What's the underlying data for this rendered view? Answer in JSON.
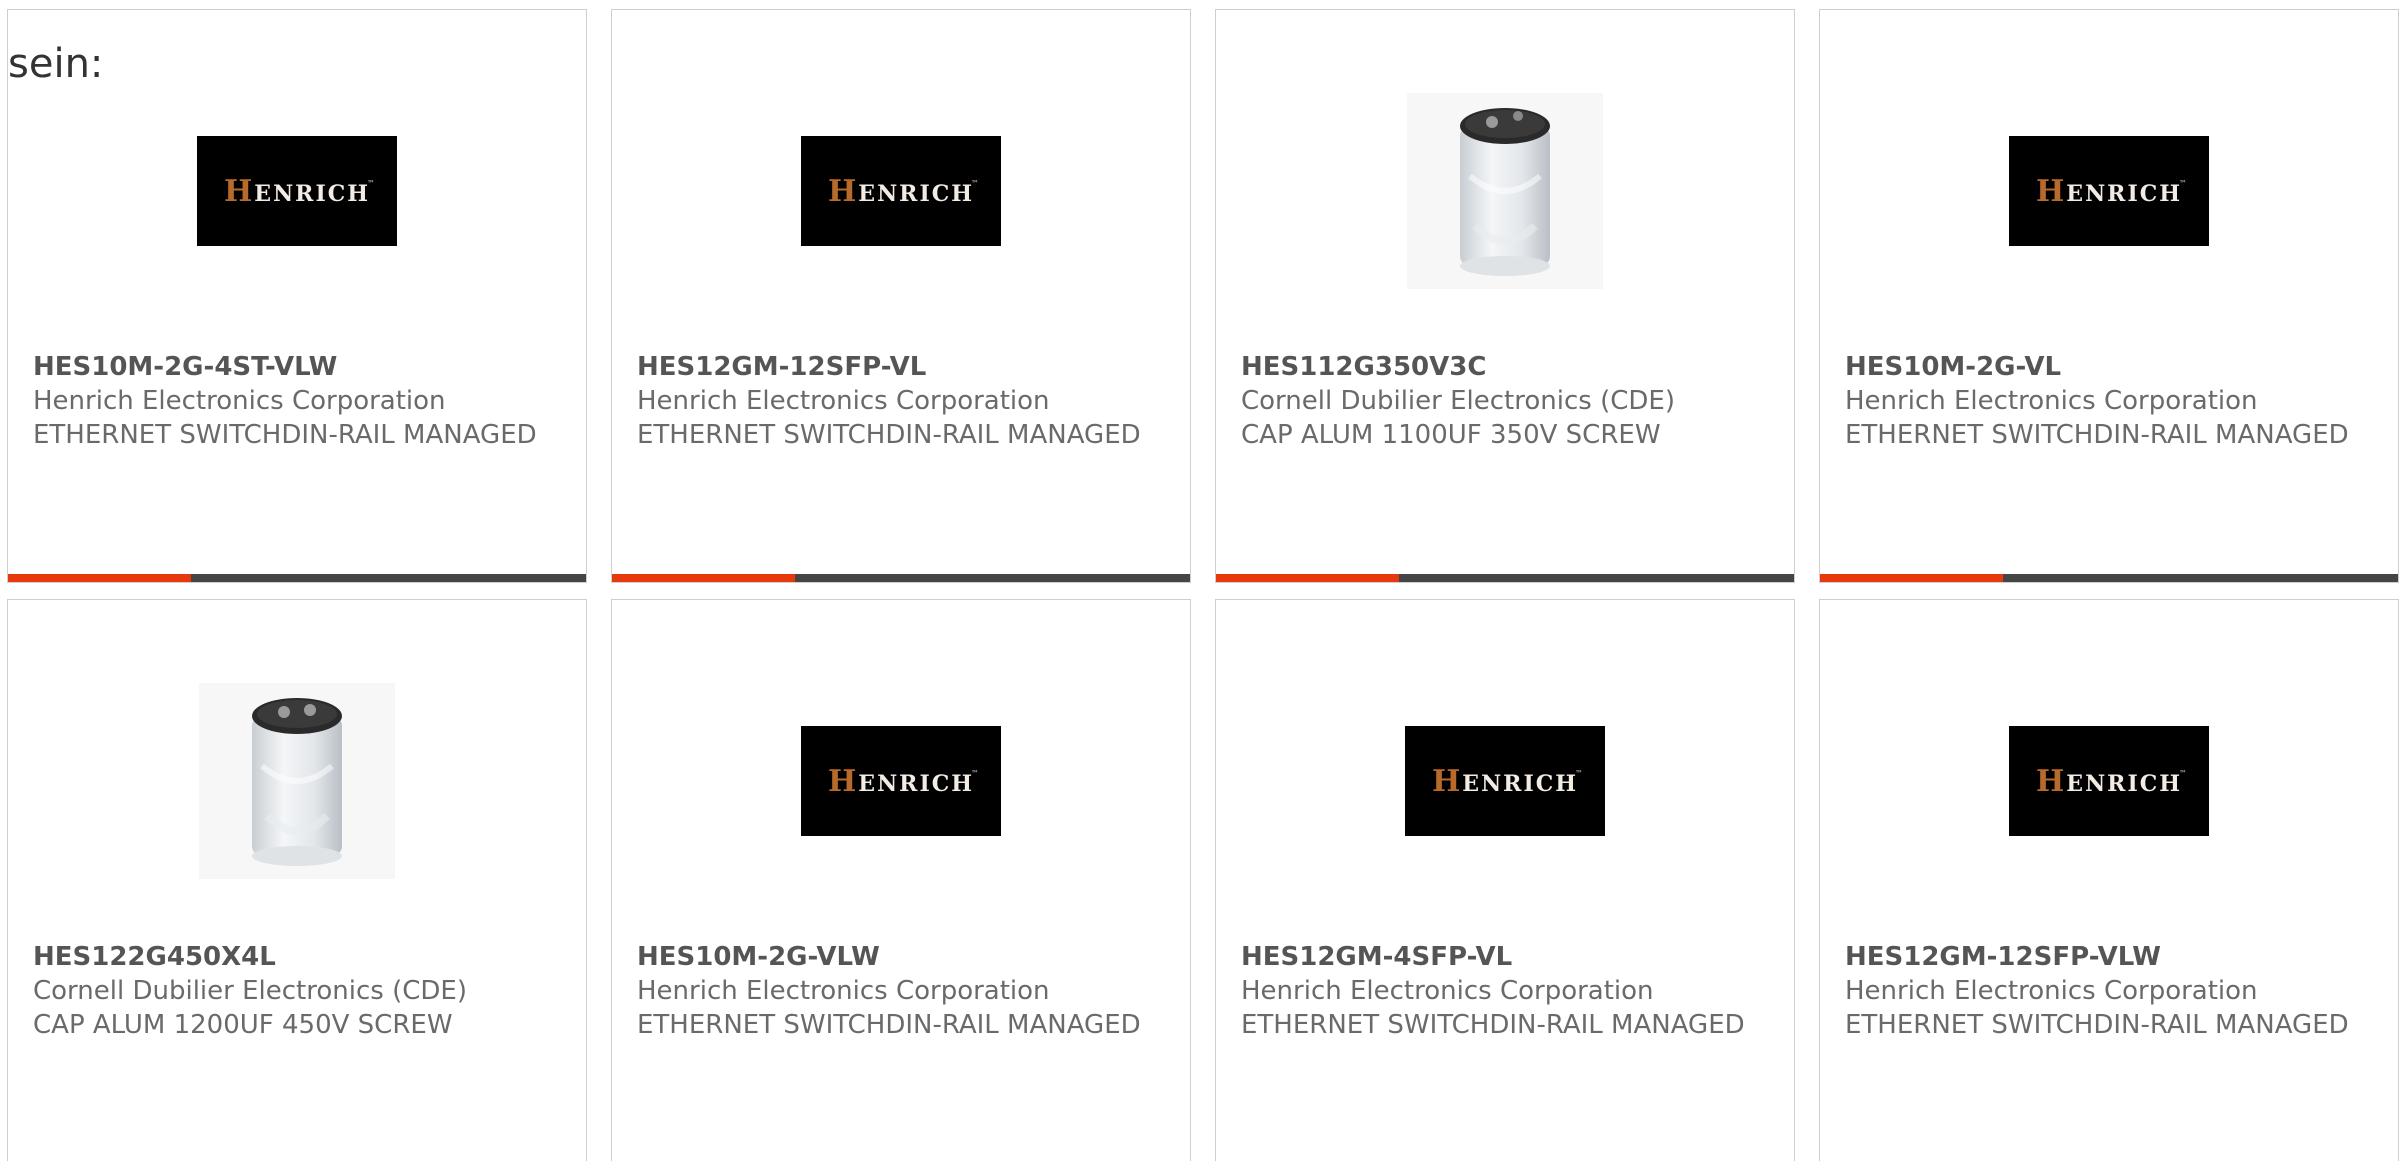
{
  "intro_text": "sein:",
  "colors": {
    "accent": "#e8380d",
    "bar_dark": "#454545",
    "card_border": "#cfcfcf"
  },
  "henrich_logo": {
    "text_first": "H",
    "text_rest": "ENRICH",
    "tm": "™"
  },
  "products": [
    {
      "part_number": "HES10M-2G-4ST-VLW",
      "manufacturer": "Henrich Electronics Corporation",
      "description": "ETHERNET SWITCHDIN-RAIL MANAGED",
      "image": "henrich-logo"
    },
    {
      "part_number": "HES12GM-12SFP-VL",
      "manufacturer": "Henrich Electronics Corporation",
      "description": "ETHERNET SWITCHDIN-RAIL MANAGED",
      "image": "henrich-logo"
    },
    {
      "part_number": "HES112G350V3C",
      "manufacturer": "Cornell Dubilier Electronics (CDE)",
      "description": "CAP ALUM 1100UF 350V SCREW",
      "image": "capacitor-photo"
    },
    {
      "part_number": "HES10M-2G-VL",
      "manufacturer": "Henrich Electronics Corporation",
      "description": "ETHERNET SWITCHDIN-RAIL MANAGED",
      "image": "henrich-logo"
    },
    {
      "part_number": "HES122G450X4L",
      "manufacturer": "Cornell Dubilier Electronics (CDE)",
      "description": "CAP ALUM 1200UF 450V SCREW",
      "image": "capacitor-photo"
    },
    {
      "part_number": "HES10M-2G-VLW",
      "manufacturer": "Henrich Electronics Corporation",
      "description": "ETHERNET SWITCHDIN-RAIL MANAGED",
      "image": "henrich-logo"
    },
    {
      "part_number": "HES12GM-4SFP-VL",
      "manufacturer": "Henrich Electronics Corporation",
      "description": "ETHERNET SWITCHDIN-RAIL MANAGED",
      "image": "henrich-logo"
    },
    {
      "part_number": "HES12GM-12SFP-VLW",
      "manufacturer": "Henrich Electronics Corporation",
      "description": "ETHERNET SWITCHDIN-RAIL MANAGED",
      "image": "henrich-logo"
    }
  ]
}
